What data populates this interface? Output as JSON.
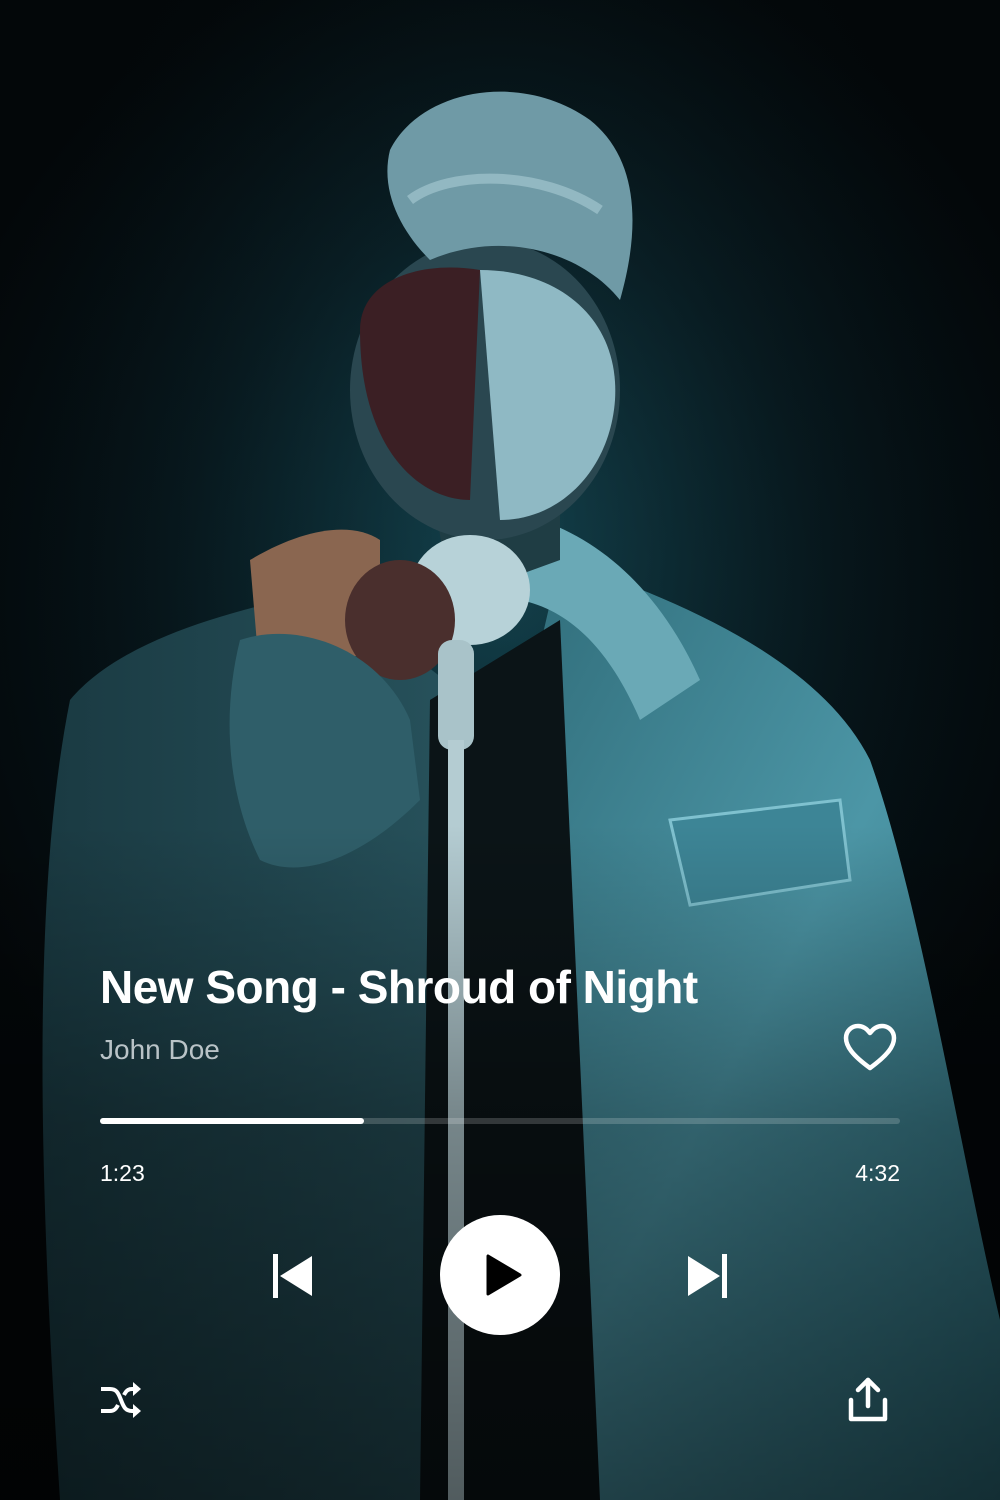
{
  "track": {
    "title": "New Song - Shroud of Night",
    "artist": "John Doe",
    "liked": false
  },
  "playback": {
    "elapsed": "1:23",
    "duration": "4:32",
    "progress_fraction": 0.33,
    "state": "paused"
  },
  "artwork": {
    "description_icon": "singer-with-microphone-photo",
    "tint_color": "#4fa8b8"
  },
  "controls": {
    "icons": {
      "like": "heart-icon",
      "previous": "skip-previous-icon",
      "play": "play-icon",
      "next": "skip-next-icon",
      "shuffle": "shuffle-icon",
      "share": "share-icon"
    }
  },
  "colors": {
    "background": "#05090c",
    "text_primary": "#ffffff",
    "text_secondary": "#b9c3c7",
    "progress_fill": "#ffffff",
    "progress_track": "#2b3337"
  }
}
